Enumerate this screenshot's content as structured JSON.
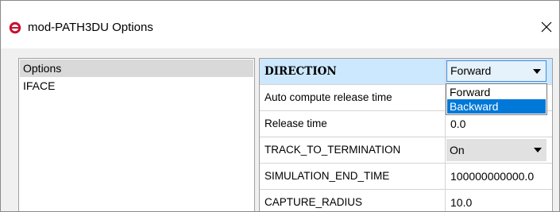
{
  "window": {
    "title": "mod-PATH3DU Options",
    "icon": "app-logo-icon",
    "close_icon": "close-icon"
  },
  "nav": {
    "items": [
      {
        "label": "Options",
        "selected": true
      },
      {
        "label": "IFACE",
        "selected": false
      }
    ]
  },
  "grid": {
    "rows": [
      {
        "label": "DIRECTION",
        "value": "Forward",
        "type": "combo",
        "bold": true,
        "selected": true
      },
      {
        "label": "Auto compute release time",
        "value": "",
        "type": "text"
      },
      {
        "label": "Release time",
        "value": "0.0",
        "type": "text"
      },
      {
        "label": "TRACK_TO_TERMINATION",
        "value": "On",
        "type": "combo"
      },
      {
        "label": "SIMULATION_END_TIME",
        "value": "100000000000.0",
        "type": "text"
      },
      {
        "label": "CAPTURE_RADIUS",
        "value": "10.0",
        "type": "text"
      }
    ]
  },
  "dropdown": {
    "open": true,
    "options": [
      {
        "label": "Forward",
        "highlighted": false
      },
      {
        "label": "Backward",
        "highlighted": true
      }
    ]
  },
  "colors": {
    "accent": "#0078d7",
    "selected_row": "#cce8ff",
    "app_icon": "#c8102e"
  }
}
